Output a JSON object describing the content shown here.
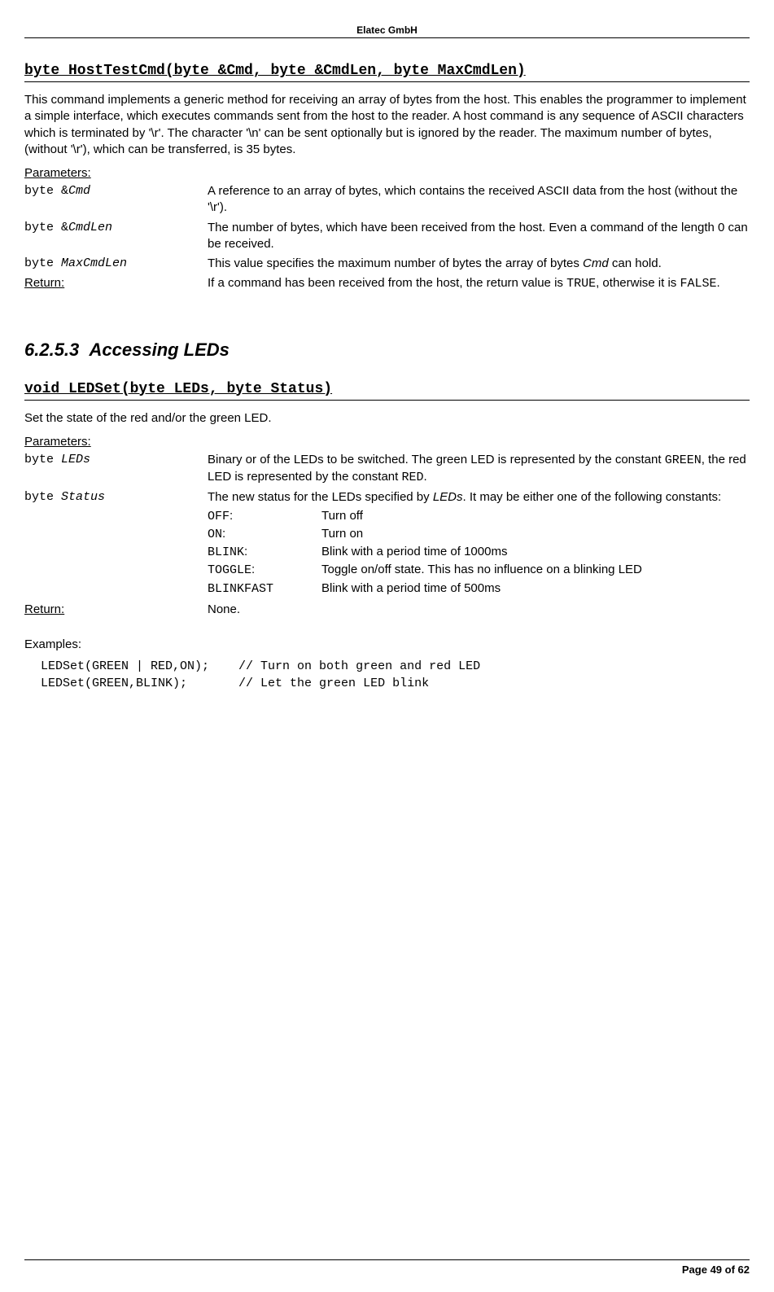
{
  "header": {
    "company": "Elatec GmbH"
  },
  "func1": {
    "signature": "byte HostTestCmd(byte &Cmd, byte &CmdLen, byte MaxCmdLen)",
    "desc": "This command implements a generic method for receiving an array of bytes from the host. This enables the programmer to implement a simple interface, which executes commands sent from the host to the reader. A host command is any sequence of ASCII characters which is terminated by '\\r'. The character '\\n' can be sent optionally but is ignored by the reader. The maximum number of bytes, (without '\\r'), which can be transferred, is 35 bytes.",
    "paramsLabel": "Parameters:",
    "params": [
      {
        "name_prefix": "byte &",
        "name_italic": "Cmd",
        "text": "A reference to an array of bytes, which contains the received ASCII data from the host (without the '\\r')."
      },
      {
        "name_prefix": "byte &",
        "name_italic": "CmdLen",
        "text": "The number of bytes, which have been received from the host. Even a command of the length 0 can be received."
      },
      {
        "name_prefix": "byte ",
        "name_italic": "MaxCmdLen",
        "text_pre": "This value specifies the maximum number of bytes the array of bytes ",
        "text_italic": "Cmd",
        "text_post": " can hold."
      }
    ],
    "returnLabel": "Return:",
    "return_pre": "If a command has been received from the host, the return value is ",
    "return_code1": "TRUE",
    "return_mid": ", otherwise it is ",
    "return_code2": "FALSE",
    "return_post": "."
  },
  "section": {
    "number": "6.2.5.3",
    "title": "Accessing LEDs"
  },
  "func2": {
    "signature": "void LEDSet(byte LEDs, byte Status)",
    "desc": "Set the state of the red and/or the green LED.",
    "paramsLabel": "Parameters:",
    "p1_name_prefix": "byte ",
    "p1_name_italic": "LEDs",
    "p1_text_pre": "Binary or of the LEDs to be switched. The green LED is represented by the constant ",
    "p1_code1": "GREEN",
    "p1_mid": ", the red LED is represented by the constant ",
    "p1_code2": "RED",
    "p1_post": ".",
    "p2_name_prefix": "byte ",
    "p2_name_italic": "Status",
    "p2_text_pre": "The new status for the LEDs specified by ",
    "p2_text_italic": "LEDs",
    "p2_text_post": ". It may be either one of the following constants:",
    "statuses": [
      {
        "code": "OFF",
        "colon": ":",
        "desc": "Turn off"
      },
      {
        "code": "ON",
        "colon": ":",
        "desc": "Turn on"
      },
      {
        "code": "BLINK",
        "colon": ":",
        "desc": "Blink with a period time of 1000ms"
      },
      {
        "code": "TOGGLE",
        "colon": ":",
        "desc": "Toggle on/off state. This has no influence on a blinking LED"
      },
      {
        "code": "BLINKFAST",
        "colon": "",
        "desc": "Blink with a period time of 500ms"
      }
    ],
    "returnLabel": "Return:",
    "returnText": "None.",
    "examplesLabel": "Examples:",
    "code": "LEDSet(GREEN | RED,ON);    // Turn on both green and red LED\nLEDSet(GREEN,BLINK);       // Let the green LED blink"
  },
  "footer": {
    "text": "Page 49 of 62"
  }
}
